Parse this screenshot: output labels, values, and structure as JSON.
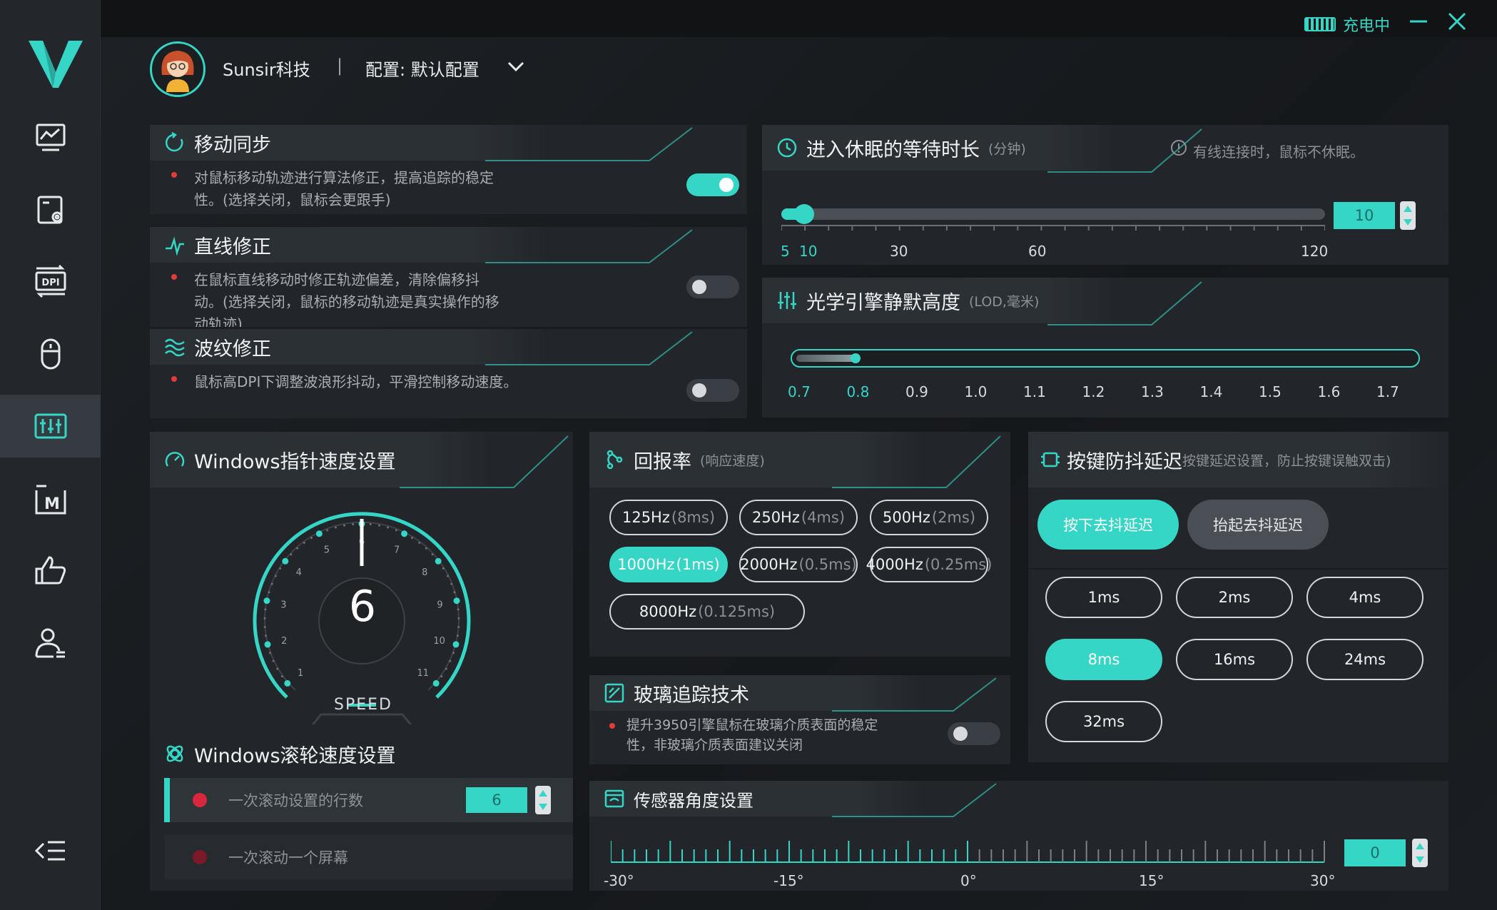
{
  "window": {
    "charge_status": "充电中"
  },
  "header": {
    "user_name": "Sunsir科技",
    "separator": "|",
    "config_label": "配置: 默认配置"
  },
  "motion_sync": {
    "title": "移动同步",
    "desc_line1": "对鼠标移动轨迹进行算法修正，提高追踪的稳定",
    "desc_line2": "性。(选择关闭，鼠标会更跟手)",
    "enabled": true
  },
  "line_correction": {
    "title": "直线修正",
    "desc_line1": "在鼠标直线移动时修正轨迹偏差，清除偏移抖",
    "desc_line2": "动。(选择关闭，鼠标的移动轨迹是真实操作的移",
    "desc_line3": "动轨迹)",
    "enabled": false
  },
  "ripple_correction": {
    "title": "波纹修正",
    "desc": "鼠标高DPI下调整波浪形抖动，平滑控制移动速度。",
    "enabled": false
  },
  "sleep": {
    "title": "进入休眠的等待时长",
    "unit": "(分钟)",
    "note": "有线连接时，鼠标不休眠。",
    "value": "10",
    "range": [
      5,
      120
    ],
    "labels": [
      "5",
      "10",
      "30",
      "60",
      "120"
    ]
  },
  "lod": {
    "title": "光学引擎静默高度",
    "unit": "(LOD,毫米)",
    "value": 0.8,
    "labels": [
      "0.7",
      "0.8",
      "0.9",
      "1.0",
      "1.1",
      "1.2",
      "1.3",
      "1.4",
      "1.5",
      "1.6",
      "1.7"
    ]
  },
  "pointer_speed": {
    "title": "Windows指针速度设置",
    "value": "6",
    "gauge_label": "SPEED",
    "ticks": [
      "1",
      "2",
      "3",
      "4",
      "5",
      "6",
      "7",
      "8",
      "9",
      "10",
      "11"
    ]
  },
  "scroll_speed": {
    "title": "Windows滚轮速度设置",
    "option1": "一次滚动设置的行数",
    "option1_value": "6",
    "option2": "一次滚动一个屏幕"
  },
  "polling": {
    "title": "回报率",
    "unit": "(响应速度)",
    "options": [
      {
        "hz": "125Hz",
        "ms": "(8ms)"
      },
      {
        "hz": "250Hz",
        "ms": "(4ms)"
      },
      {
        "hz": "500Hz",
        "ms": "(2ms)"
      },
      {
        "hz": "1000Hz",
        "ms": "(1ms)"
      },
      {
        "hz": "2000Hz",
        "ms": "(0.5ms)"
      },
      {
        "hz": "4000Hz",
        "ms": "(0.25ms)"
      },
      {
        "hz": "8000Hz",
        "ms": "(0.125ms)"
      }
    ],
    "selected_index": 3
  },
  "debounce": {
    "title": "按键防抖延迟",
    "subtitle": "按键延迟设置，防止按键误触双击)",
    "tab_press": "按下去抖延迟",
    "tab_release": "抬起去抖延迟",
    "options": [
      "1ms",
      "2ms",
      "4ms",
      "8ms",
      "16ms",
      "24ms",
      "32ms"
    ],
    "selected_index": 3
  },
  "glass": {
    "title": "玻璃追踪技术",
    "desc_line1": "提升3950引擎鼠标在玻璃介质表面的稳定",
    "desc_line2": "性，非玻璃介质表面建议关闭",
    "enabled": false
  },
  "sensor_angle": {
    "title": "传感器角度设置",
    "value": "0",
    "labels": [
      "-30°",
      "-15°",
      "0°",
      "15°",
      "30°"
    ],
    "min": -30,
    "max": 30
  },
  "colors": {
    "accent": "#35d6c5",
    "panel": "#22262a",
    "panel_head": "#2b3035",
    "sidebar": "#23272b",
    "danger": "#e23b3b"
  }
}
